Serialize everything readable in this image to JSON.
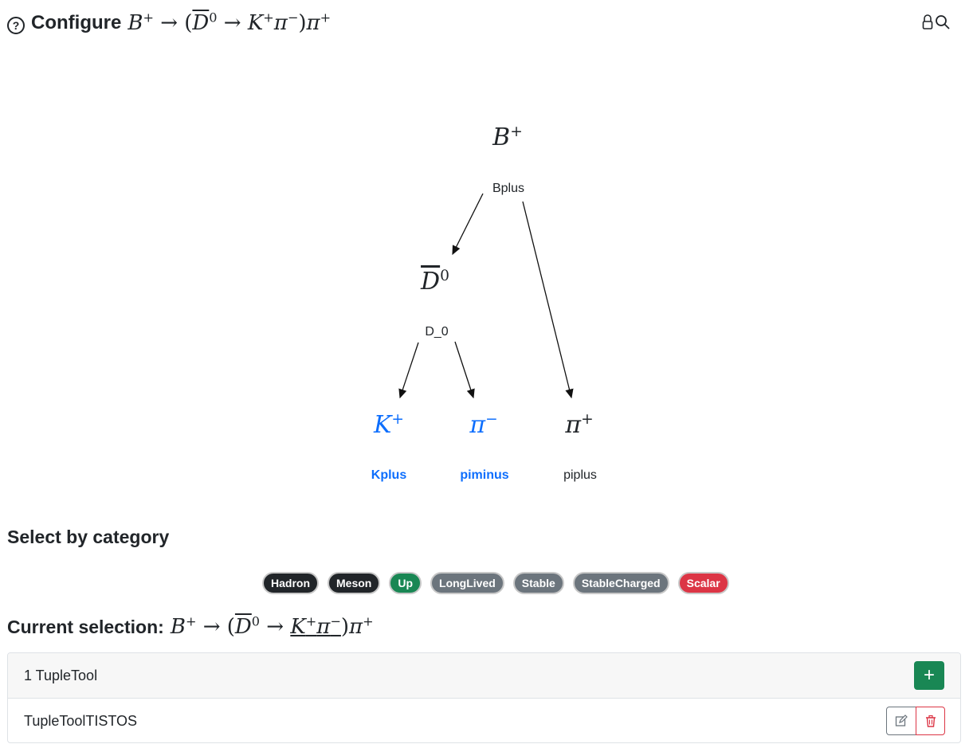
{
  "header": {
    "title_label": "Configure",
    "title_decay": {
      "mother": "B",
      "mother_charge": "+",
      "arrow": "→",
      "open": "(",
      "d": "D",
      "d_charge": "0",
      "k": "K",
      "k_charge": "+",
      "pi": "π",
      "pi_minus": "−",
      "close": ")",
      "pi2": "π",
      "pi2_charge": "+"
    },
    "icons": [
      "help-icon",
      "lock-icon",
      "search-icon"
    ]
  },
  "tree": {
    "nodes": [
      {
        "id": "bplus",
        "symbol": "B",
        "charge": "+",
        "label": "Bplus",
        "selected": false
      },
      {
        "id": "d0",
        "symbol": "D",
        "charge": "0",
        "label": "D_0",
        "selected": false
      },
      {
        "id": "kplus",
        "symbol": "K",
        "charge": "+",
        "label": "Kplus",
        "selected": true
      },
      {
        "id": "piminus",
        "symbol": "π",
        "charge": "−",
        "label": "piminus",
        "selected": true
      },
      {
        "id": "piplus",
        "symbol": "π",
        "charge": "+",
        "label": "piplus",
        "selected": false
      }
    ]
  },
  "category": {
    "title": "Select by category",
    "badges": [
      {
        "label": "Hadron",
        "color": "#212529"
      },
      {
        "label": "Meson",
        "color": "#212529"
      },
      {
        "label": "Up",
        "color": "#198754"
      },
      {
        "label": "LongLived",
        "color": "#6c757d"
      },
      {
        "label": "Stable",
        "color": "#6c757d"
      },
      {
        "label": "StableCharged",
        "color": "#6c757d"
      },
      {
        "label": "Scalar",
        "color": "#dc3545"
      }
    ]
  },
  "selection": {
    "title": "Current selection:",
    "tool_count_label": "1 TupleTool",
    "tools": [
      {
        "name": "TupleToolTISTOS"
      }
    ]
  },
  "colors": {
    "accent": "#0d6efd",
    "success": "#198754",
    "danger": "#dc3545"
  }
}
